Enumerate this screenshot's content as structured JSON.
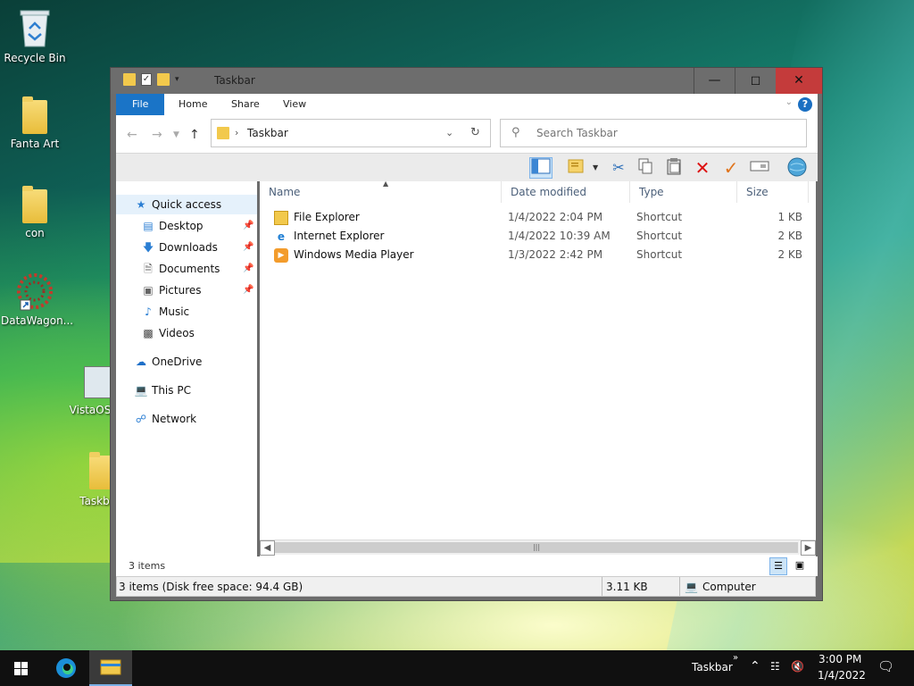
{
  "desktop": {
    "icons": [
      {
        "label": "Recycle Bin"
      },
      {
        "label": "Fanta Art"
      },
      {
        "label": "con"
      },
      {
        "label": "DataWagon..."
      },
      {
        "label": "VistaOS"
      },
      {
        "label": "Taskb"
      }
    ]
  },
  "window": {
    "title": "Taskbar",
    "ribbon_tabs": [
      "File",
      "Home",
      "Share",
      "View"
    ],
    "address": {
      "crumb": "Taskbar"
    },
    "search": {
      "placeholder": "Search Taskbar"
    },
    "toolbar_icons": [
      "preview-pane-icon",
      "new-folder-icon",
      "cut-icon",
      "copy-icon",
      "paste-icon",
      "delete-icon",
      "accept-icon",
      "rename-icon",
      "globe-icon"
    ],
    "nav": {
      "quick_access": "Quick access",
      "items": [
        {
          "label": "Desktop",
          "pinned": true
        },
        {
          "label": "Downloads",
          "pinned": true
        },
        {
          "label": "Documents",
          "pinned": true
        },
        {
          "label": "Pictures",
          "pinned": true
        },
        {
          "label": "Music",
          "pinned": false
        },
        {
          "label": "Videos",
          "pinned": false
        }
      ],
      "onedrive": "OneDrive",
      "thispc": "This PC",
      "network": "Network"
    },
    "columns": {
      "name": "Name",
      "date": "Date modified",
      "type": "Type",
      "size": "Size"
    },
    "files": [
      {
        "name": "File Explorer",
        "date": "1/4/2022 2:04 PM",
        "type": "Shortcut",
        "size": "1 KB"
      },
      {
        "name": "Internet Explorer",
        "date": "1/4/2022 10:39 AM",
        "type": "Shortcut",
        "size": "2 KB"
      },
      {
        "name": "Windows Media Player",
        "date": "1/3/2022 2:42 PM",
        "type": "Shortcut",
        "size": "2 KB"
      }
    ],
    "item_count": "3 items",
    "status": {
      "summary": "3 items (Disk free space: 94.4 GB)",
      "size": "3.11 KB",
      "location": "Computer"
    }
  },
  "taskbar": {
    "tray_label": "Taskbar",
    "time": "3:00 PM",
    "date": "1/4/2022"
  }
}
